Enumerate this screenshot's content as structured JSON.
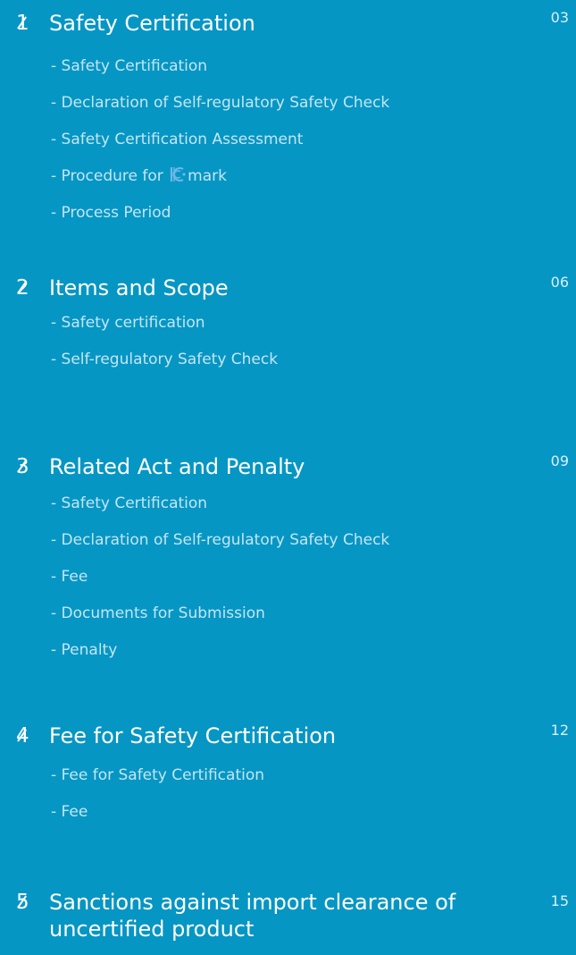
{
  "sections": [
    {
      "num": "1",
      "title": "Safety Certification",
      "page": "03",
      "items": [
        "- Safety Certification",
        "- Declaration of Self-regulatory Safety Check",
        "- Safety Certification Assessment",
        "- Procedure for",
        "- Process Period"
      ],
      "kmark_after": "mark"
    },
    {
      "num": "2",
      "title": "Items and Scope",
      "page": "06",
      "items": [
        "- Safety certification",
        "- Self-regulatory Safety Check"
      ]
    },
    {
      "num": "3",
      "title": "Related Act and Penalty",
      "page": "09",
      "items": [
        "- Safety Certification",
        "- Declaration of Self-regulatory Safety Check",
        "- Fee",
        "- Documents for Submission",
        "- Penalty"
      ]
    },
    {
      "num": "4",
      "title": "Fee for Safety Certification",
      "page": "12",
      "items": [
        "- Fee for Safety Certification",
        "- Fee"
      ]
    },
    {
      "num": "5",
      "title": "Sanctions against import clearance of uncertified product",
      "page": "15",
      "items": []
    }
  ],
  "colors": {
    "background": "#0596c4",
    "item_text": "#c4e6f2",
    "kc_mark": "#6fb7e6"
  },
  "icons": {
    "kc_mark": "kc-certification-mark-icon"
  }
}
